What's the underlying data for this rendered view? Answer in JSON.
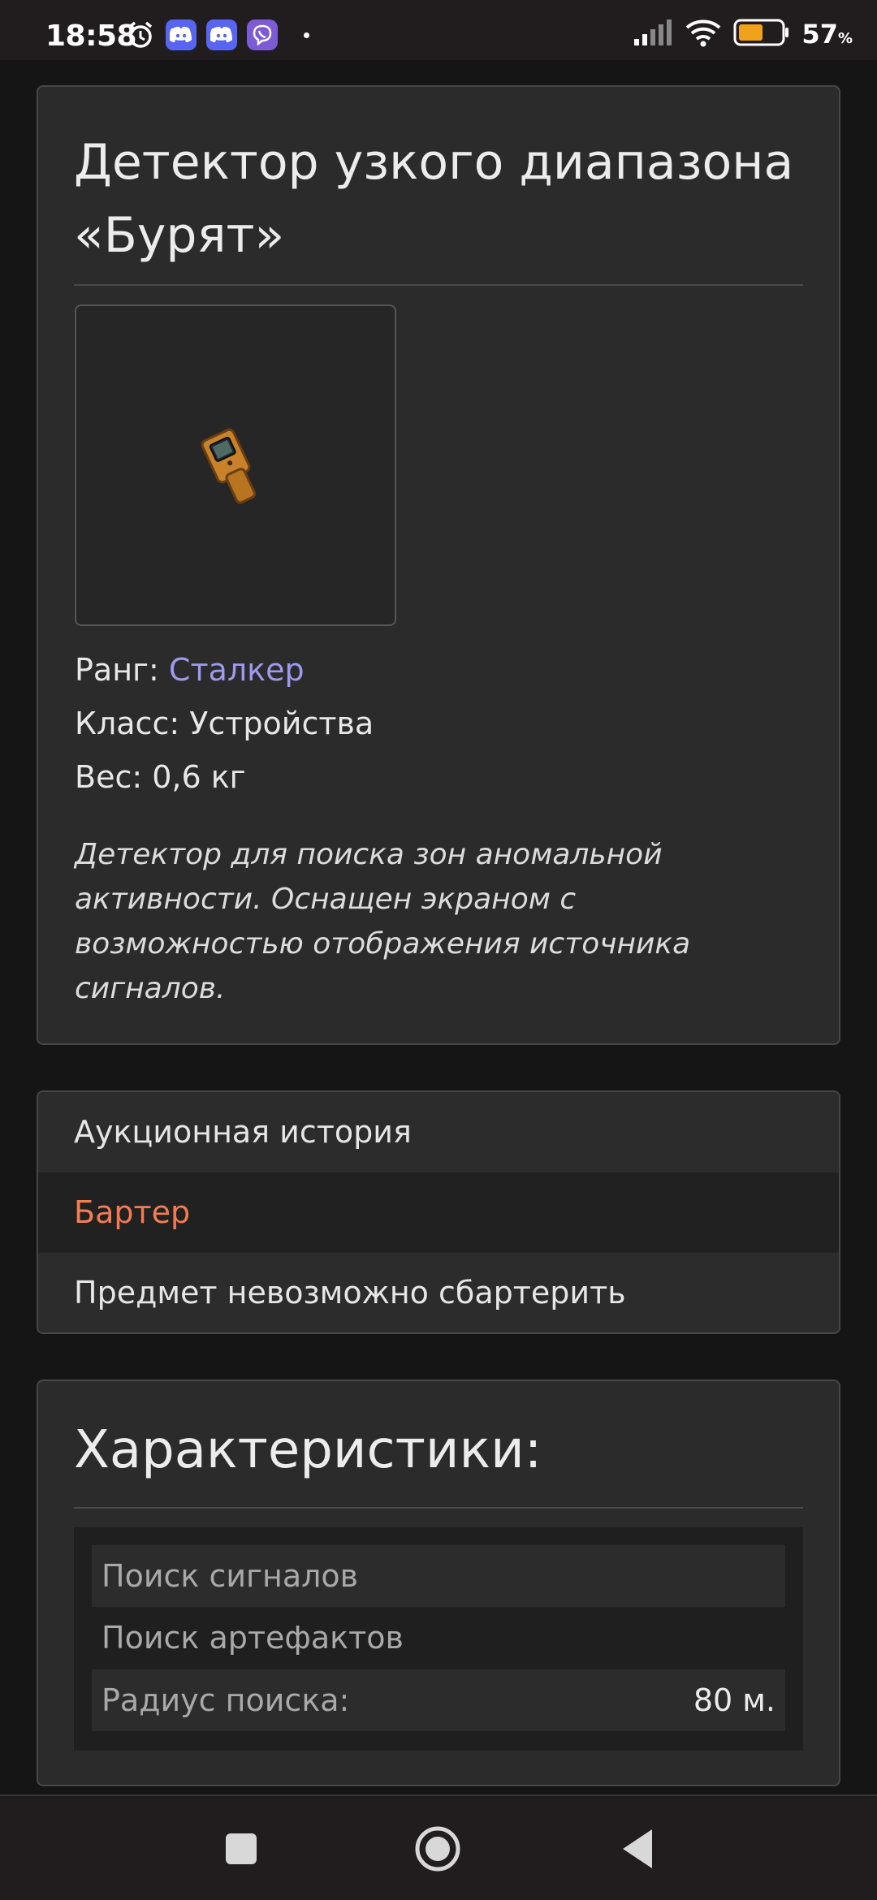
{
  "status_bar": {
    "time": "18:58",
    "battery_percent": "57",
    "battery_unit": "%",
    "battery_level": 0.57,
    "icons": [
      "alarm-icon",
      "discord-icon",
      "discord-icon",
      "viber-icon",
      "notification-dot",
      "signal-icon",
      "wifi-icon",
      "battery-icon"
    ]
  },
  "item": {
    "title": "Детектор узкого диапазона «Бурят»",
    "rank_label": "Ранг: ",
    "rank_value": "Сталкер",
    "class_text": "Класс: Устройства",
    "weight_text": "Вес: 0,6 кг",
    "description": "Детектор для поиска зон аномальной активности. Оснащен экраном с возможностью отображения источника сигналов."
  },
  "menu": {
    "items": [
      {
        "label": "Аукционная история"
      },
      {
        "label": "Бартер"
      },
      {
        "label": "Предмет невозможно сбартерить"
      }
    ]
  },
  "stats": {
    "title": "Характеристики:",
    "rows": [
      {
        "label": "Поиск сигналов",
        "value": ""
      },
      {
        "label": "Поиск артефактов",
        "value": ""
      },
      {
        "label": "Радиус поиска:",
        "value": "80 м."
      }
    ]
  },
  "nav": {
    "buttons": [
      "recents-button",
      "home-button",
      "back-button"
    ]
  },
  "colors": {
    "accent_link": "#9d9aef",
    "active_menu": "#f47c50",
    "battery": "#f0a21b"
  }
}
